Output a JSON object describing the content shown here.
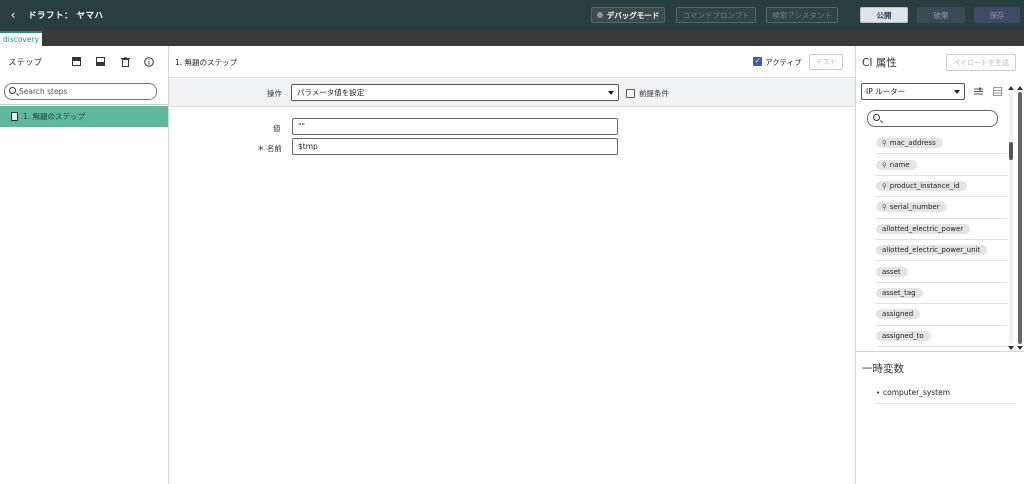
{
  "header": {
    "back_icon": "chevron-left-icon",
    "title": "ドラフト： ヤマハ",
    "debug_label": "デバッグモード",
    "command_prompt_label": "コマンドプロンプト",
    "search_assistant_label": "検索アシスタント",
    "publish_label": "公開",
    "discard_label": "破棄",
    "save_label": "保存",
    "colors": {
      "bar": "#293e40",
      "publish_bg": "#dfe3ea"
    }
  },
  "tabs": {
    "active": "discovery"
  },
  "left": {
    "title": "ステップ",
    "search_placeholder": "Search steps",
    "steps": [
      {
        "label": "1. 無題のステップ"
      }
    ],
    "colors": {
      "selected": "#5eb99c"
    }
  },
  "center": {
    "step_title": "1. 無題のステップ",
    "active_label": "アクティブ",
    "active_checked": true,
    "test_label": "テスト",
    "operation_label": "操作",
    "operation_value": "パラメータ値を設定",
    "precondition_label": "前提条件",
    "value_label": "値",
    "value_value": "\"\"",
    "name_label": "＊ 名前",
    "name_value": "$tmp"
  },
  "right": {
    "ci_title": "CI 属性",
    "payload_label": "ペイロードを生成",
    "ci_type_value": "IP ルーター",
    "attributes": [
      {
        "name": "mac_address",
        "key": true
      },
      {
        "name": "name",
        "key": true
      },
      {
        "name": "product_instance_id",
        "key": true
      },
      {
        "name": "serial_number",
        "key": true
      },
      {
        "name": "allotted_electric_power",
        "key": false
      },
      {
        "name": "allotted_electric_power_unit",
        "key": false
      },
      {
        "name": "asset",
        "key": false
      },
      {
        "name": "asset_tag",
        "key": false
      },
      {
        "name": "assigned",
        "key": false
      },
      {
        "name": "assigned_to",
        "key": false
      }
    ],
    "temp_title": "一時変数",
    "temp_vars": [
      "computer_system"
    ]
  }
}
